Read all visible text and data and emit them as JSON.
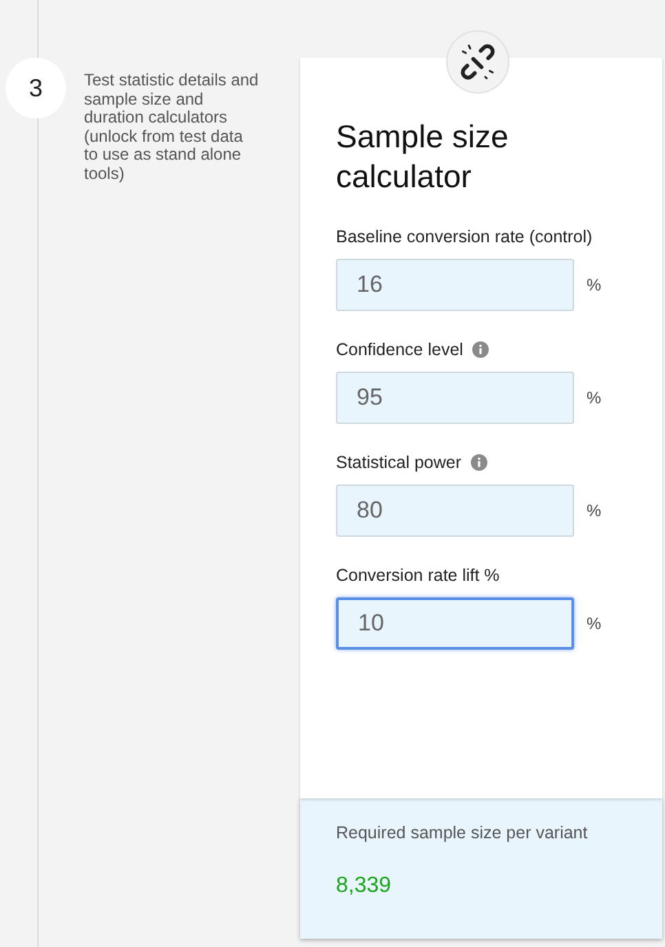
{
  "step": {
    "number": "3",
    "description": "Test statistic details and sample size and duration calculators (unlock from test data to use as stand alone tools)"
  },
  "card": {
    "title": "Sample size calculator",
    "fields": [
      {
        "label": "Baseline conversion rate (control)",
        "info": false,
        "value": "16",
        "unit": "%",
        "focused": false
      },
      {
        "label": "Confidence level",
        "info": true,
        "value": "95",
        "unit": "%",
        "focused": false
      },
      {
        "label": "Statistical power",
        "info": true,
        "value": "80",
        "unit": "%",
        "focused": false
      },
      {
        "label": "Conversion rate lift %",
        "info": false,
        "value": "10",
        "unit": "%",
        "focused": true
      }
    ]
  },
  "result": {
    "label": "Required sample size per variant",
    "value": "8,339"
  }
}
